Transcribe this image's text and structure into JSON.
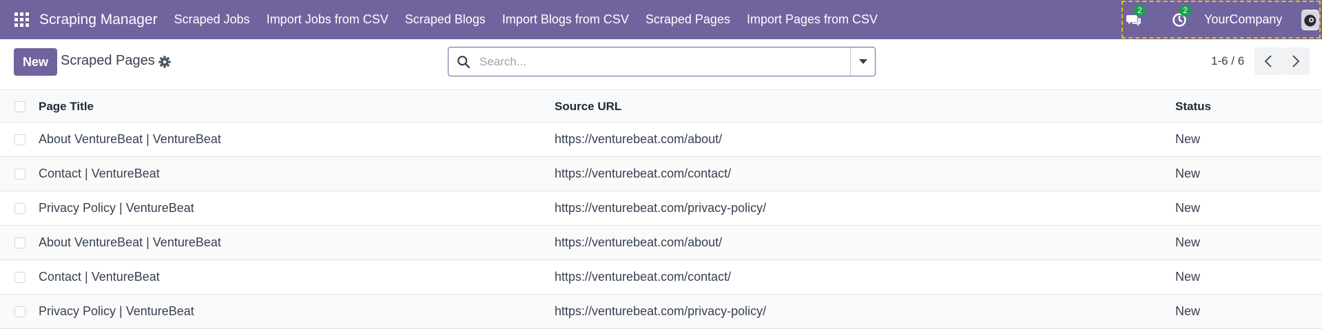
{
  "navbar": {
    "app_name": "Scraping Manager",
    "menu": [
      {
        "label": "Scraped Jobs"
      },
      {
        "label": "Import Jobs from CSV"
      },
      {
        "label": "Scraped Blogs"
      },
      {
        "label": "Import Blogs from CSV"
      },
      {
        "label": "Scraped Pages"
      },
      {
        "label": "Import Pages from CSV"
      }
    ],
    "systray": {
      "messages_count": "2",
      "activities_count": "2",
      "company": "YourCompany"
    },
    "colors": {
      "primary": "#71639e",
      "badge": "#16a34a"
    }
  },
  "control_panel": {
    "new_label": "New",
    "title": "Scraped Pages",
    "search_placeholder": "Search...",
    "pager": "1-6 / 6"
  },
  "table": {
    "headers": {
      "page_title": "Page Title",
      "source_url": "Source URL",
      "status": "Status"
    },
    "rows": [
      {
        "title": "About VentureBeat | VentureBeat",
        "url": "https://venturebeat.com/about/",
        "status": "New"
      },
      {
        "title": "Contact | VentureBeat",
        "url": "https://venturebeat.com/contact/",
        "status": "New"
      },
      {
        "title": "Privacy Policy | VentureBeat",
        "url": "https://venturebeat.com/privacy-policy/",
        "status": "New"
      },
      {
        "title": "About VentureBeat | VentureBeat",
        "url": "https://venturebeat.com/about/",
        "status": "New"
      },
      {
        "title": "Contact | VentureBeat",
        "url": "https://venturebeat.com/contact/",
        "status": "New"
      },
      {
        "title": "Privacy Policy | VentureBeat",
        "url": "https://venturebeat.com/privacy-policy/",
        "status": "New"
      }
    ]
  },
  "icons": [
    "apps-grid-icon",
    "chat-icon",
    "clock-icon",
    "gear-icon",
    "search-icon",
    "caret-down-icon",
    "chevron-left-icon",
    "chevron-right-icon"
  ]
}
